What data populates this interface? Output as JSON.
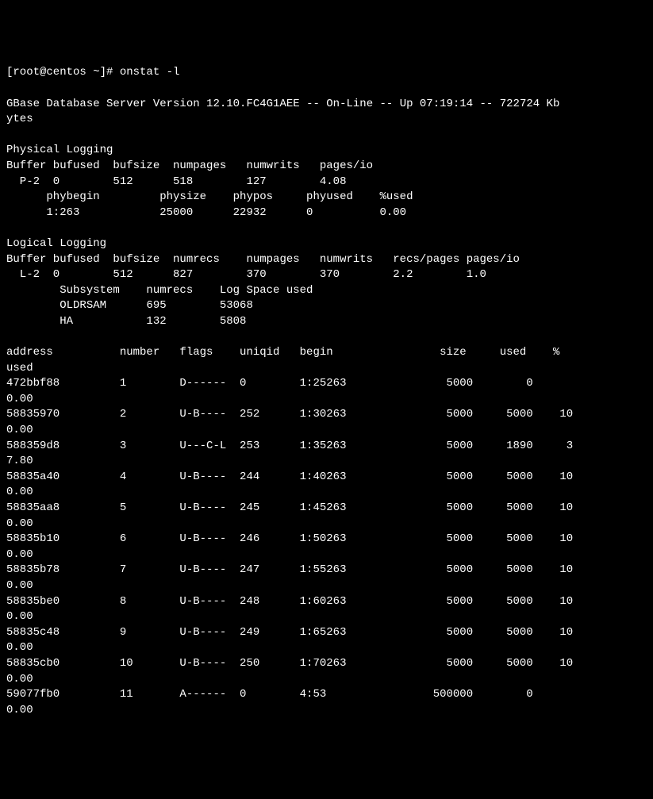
{
  "prompt": "[root@centos ~]# ",
  "command": "onstat -l",
  "header": {
    "product": "GBase Database Server Version 12.10.FC4G1AEE",
    "status": "On-Line",
    "uptime": "07:19:14",
    "memory": "722724 Kb",
    "wrap": "ytes"
  },
  "physicalLogging": {
    "title": "Physical Logging",
    "headerRow1": "Buffer bufused  bufsize  numpages   numwrits   pages/io",
    "dataRow1": "  P-2  0        512      518        127        4.08",
    "headerRow2": "      phybegin         physize    phypos     phyused    %used",
    "dataRow2": "      1:263            25000      22932      0          0.00"
  },
  "logicalLogging": {
    "title": "Logical Logging",
    "headerRow": "Buffer bufused  bufsize  numrecs    numpages   numwrits   recs/pages pages/io",
    "dataRow": "  L-2  0        512      827        370        370        2.2        1.0",
    "subHeader": "        Subsystem    numrecs    Log Space used",
    "subRow1": "        OLDRSAM      695        53068",
    "subRow2": "        HA           132        5808"
  },
  "logTable": {
    "header": "address          number   flags    uniqid   begin                size     used    %",
    "headerWrap": "used",
    "rows": [
      {
        "addr": "472bbf88",
        "number": "1",
        "flags": "D------",
        "uniqid": "0",
        "begin": "1:25263",
        "size": "5000",
        "used": "0",
        "pct": "",
        "wrap": "0.00"
      },
      {
        "addr": "58835970",
        "number": "2",
        "flags": "U-B----",
        "uniqid": "252",
        "begin": "1:30263",
        "size": "5000",
        "used": "5000",
        "pct": "10",
        "wrap": "0.00"
      },
      {
        "addr": "588359d8",
        "number": "3",
        "flags": "U---C-L",
        "uniqid": "253",
        "begin": "1:35263",
        "size": "5000",
        "used": "1890",
        "pct": "3",
        "wrap": "7.80"
      },
      {
        "addr": "58835a40",
        "number": "4",
        "flags": "U-B----",
        "uniqid": "244",
        "begin": "1:40263",
        "size": "5000",
        "used": "5000",
        "pct": "10",
        "wrap": "0.00"
      },
      {
        "addr": "58835aa8",
        "number": "5",
        "flags": "U-B----",
        "uniqid": "245",
        "begin": "1:45263",
        "size": "5000",
        "used": "5000",
        "pct": "10",
        "wrap": "0.00"
      },
      {
        "addr": "58835b10",
        "number": "6",
        "flags": "U-B----",
        "uniqid": "246",
        "begin": "1:50263",
        "size": "5000",
        "used": "5000",
        "pct": "10",
        "wrap": "0.00"
      },
      {
        "addr": "58835b78",
        "number": "7",
        "flags": "U-B----",
        "uniqid": "247",
        "begin": "1:55263",
        "size": "5000",
        "used": "5000",
        "pct": "10",
        "wrap": "0.00"
      },
      {
        "addr": "58835be0",
        "number": "8",
        "flags": "U-B----",
        "uniqid": "248",
        "begin": "1:60263",
        "size": "5000",
        "used": "5000",
        "pct": "10",
        "wrap": "0.00"
      },
      {
        "addr": "58835c48",
        "number": "9",
        "flags": "U-B----",
        "uniqid": "249",
        "begin": "1:65263",
        "size": "5000",
        "used": "5000",
        "pct": "10",
        "wrap": "0.00"
      },
      {
        "addr": "58835cb0",
        "number": "10",
        "flags": "U-B----",
        "uniqid": "250",
        "begin": "1:70263",
        "size": "5000",
        "used": "5000",
        "pct": "10",
        "wrap": "0.00"
      },
      {
        "addr": "59077fb0",
        "number": "11",
        "flags": "A------",
        "uniqid": "0",
        "begin": "4:53",
        "size": "500000",
        "used": "0",
        "pct": "",
        "wrap": "0.00"
      }
    ]
  }
}
